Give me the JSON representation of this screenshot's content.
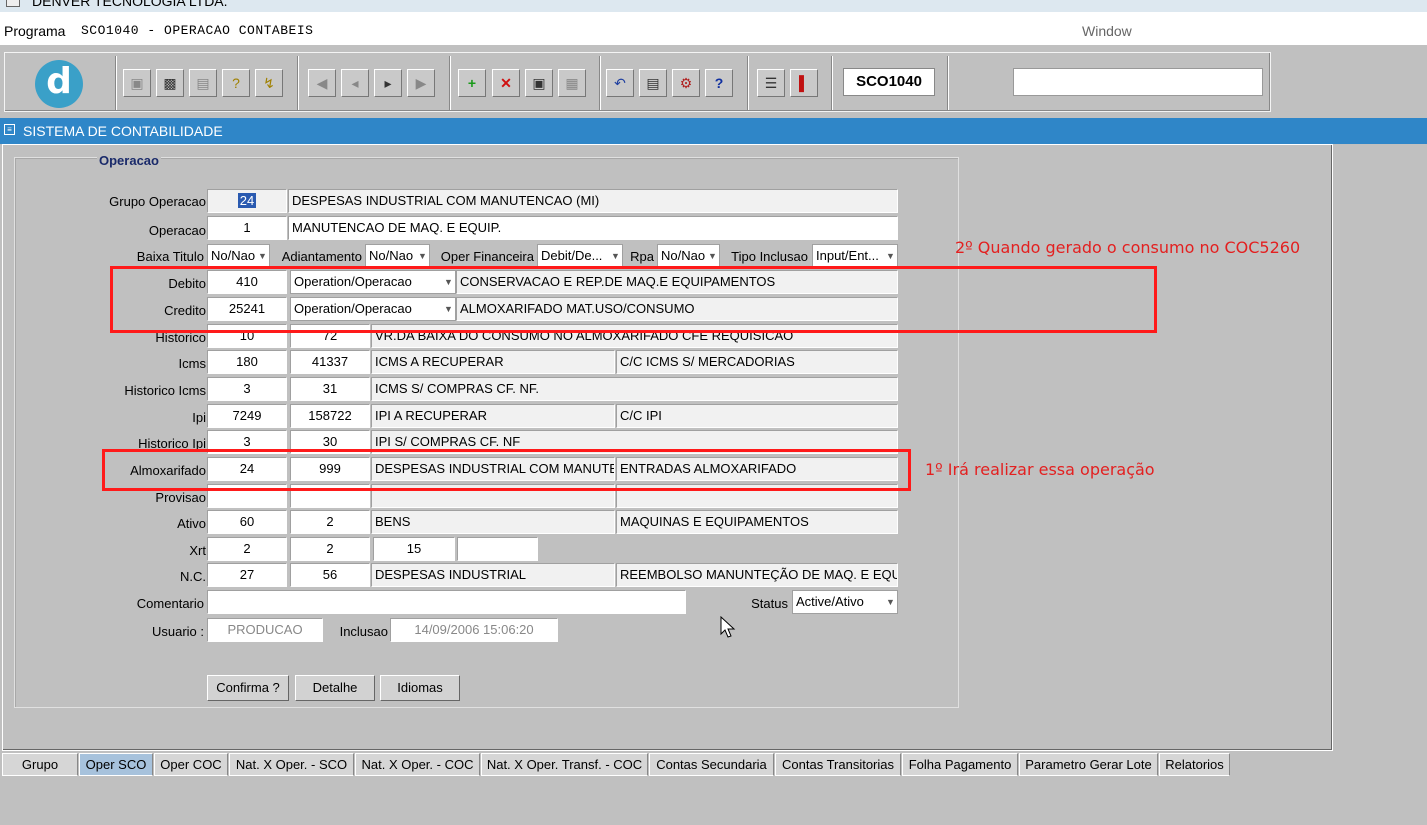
{
  "titlebar": {
    "text": "DENVER TECNOLOGIA LTDA."
  },
  "menubar": {
    "programa": "Programa",
    "title": "SCO1040 - OPERACAO CONTABEIS",
    "window": "Window"
  },
  "toolbar": {
    "logo": "d",
    "form_code": "SCO1040"
  },
  "header": {
    "title": "SISTEMA DE CONTABILIDADE"
  },
  "form": {
    "group_title": "Operacao",
    "labels": {
      "grupo_operacao": "Grupo Operacao",
      "operacao": "Operacao",
      "baixa_titulo": "Baixa Titulo",
      "adiantamento": "Adiantamento",
      "oper_financeira": "Oper Financeira",
      "rpa": "Rpa",
      "tipo_inclusao": "Tipo Inclusao",
      "debito": "Debito",
      "credito": "Credito",
      "historico": "Historico",
      "icms": "Icms",
      "historico_icms": "Historico Icms",
      "ipi": "Ipi",
      "historico_ipi": "Historico Ipi",
      "almoxarifado": "Almoxarifado",
      "provisao": "Provisao",
      "ativo": "Ativo",
      "xrt": "Xrt",
      "nc": "N.C.",
      "comentario": "Comentario",
      "status": "Status",
      "usuario": "Usuario :",
      "inclusao": "Inclusao"
    },
    "grupo_operacao": {
      "code": "24",
      "desc": "DESPESAS INDUSTRIAL COM MANUTENCAO (MI)"
    },
    "operacao": {
      "code": "1",
      "desc": "MANUTENCAO DE MAQ. E EQUIP."
    },
    "baixa_titulo": "No/Nao",
    "adiantamento": "No/Nao",
    "oper_financeira": "Debit/De...",
    "rpa": "No/Nao",
    "tipo_inclusao": "Input/Ent...",
    "debito": {
      "code": "410",
      "type": "Operation/Operacao",
      "desc": "CONSERVACAO E REP.DE MAQ.E EQUIPAMENTOS"
    },
    "credito": {
      "code": "25241",
      "type": "Operation/Operacao",
      "desc": "ALMOXARIFADO MAT.USO/CONSUMO"
    },
    "historico": {
      "a": "10",
      "b": "72",
      "desc": "VR.DA BAIXA DO CONSUMO NO ALMOXARIFADO CFE REQUISICAO"
    },
    "icms": {
      "a": "180",
      "b": "41337",
      "desc1": "ICMS A RECUPERAR",
      "desc2": "C/C ICMS S/ MERCADORIAS"
    },
    "historico_icms": {
      "a": "3",
      "b": "31",
      "desc": "ICMS S/ COMPRAS CF. NF."
    },
    "ipi": {
      "a": "7249",
      "b": "158722",
      "desc1": "IPI A RECUPERAR",
      "desc2": "C/C IPI"
    },
    "historico_ipi": {
      "a": "3",
      "b": "30",
      "desc": "IPI S/ COMPRAS CF. NF"
    },
    "almoxarifado": {
      "a": "24",
      "b": "999",
      "desc1": "DESPESAS INDUSTRIAL COM MANUTE",
      "desc2": "ENTRADAS ALMOXARIFADO"
    },
    "ativo": {
      "a": "60",
      "b": "2",
      "desc1": "BENS",
      "desc2": "MAQUINAS E EQUIPAMENTOS"
    },
    "xrt": {
      "a": "2",
      "b": "2",
      "c": "15"
    },
    "nc": {
      "a": "27",
      "b": "56",
      "desc1": "DESPESAS INDUSTRIAL",
      "desc2": "REEMBOLSO MANUNTEÇÃO DE MAQ. E EQU"
    },
    "status": "Active/Ativo",
    "usuario": "PRODUCAO",
    "inclusao": "14/09/2006 15:06:20"
  },
  "buttons": {
    "confirma": "Confirma ?",
    "detalhe": "Detalhe",
    "idiomas": "Idiomas"
  },
  "annotations": {
    "note2": "2º Quando gerado o consumo no COC5260",
    "note1": "1º Irá realizar essa operação",
    "color": "#ff1a1a"
  },
  "tabs": [
    "Grupo",
    "Oper SCO",
    "Oper COC",
    "Nat. X Oper. - SCO",
    "Nat. X Oper. - COC",
    "Nat. X Oper. Transf. - COC",
    "Contas Secundaria",
    "Contas Transitorias",
    "Folha Pagamento",
    "Parametro Gerar Lote",
    "Relatorios"
  ],
  "active_tab": "Oper SCO",
  "colors": {
    "header": "#2f86c8",
    "background": "#c0c0c0",
    "active_tab": "#a7c2dc"
  },
  "icons": [
    "save-icon",
    "window-icon",
    "print-icon",
    "query-icon",
    "execute-query-icon",
    "first-record-icon",
    "previous-record-icon",
    "next-record-icon",
    "last-record-icon",
    "insert-record-icon",
    "delete-record-icon",
    "lookup-icon",
    "clear-icon",
    "undo-icon",
    "clipboard-icon",
    "keys-icon",
    "help-icon",
    "menu-icon",
    "exit-icon"
  ]
}
